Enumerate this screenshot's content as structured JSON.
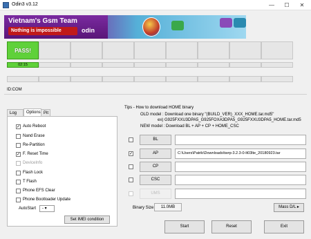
{
  "window": {
    "title": "Odin3 v3.12",
    "minimize": "—",
    "maximize": "☐",
    "close": "✕"
  },
  "banner": {
    "team": "Vietnam's Gsm Team",
    "slogan": "Nothing is impossible",
    "brand": "odin"
  },
  "slots": {
    "pass_label": "PASS!",
    "elapsed": "02:15"
  },
  "id_com": "ID:COM",
  "tabs": {
    "log": "Log",
    "options": "Options",
    "pit": "Pit"
  },
  "options": [
    {
      "label": "Auto Reboot",
      "checked": true,
      "enabled": true
    },
    {
      "label": "Nand Erase",
      "checked": false,
      "enabled": true
    },
    {
      "label": "Re-Partition",
      "checked": false,
      "enabled": true
    },
    {
      "label": "F. Reset Time",
      "checked": true,
      "enabled": true
    },
    {
      "label": "DeviceInfo",
      "checked": false,
      "enabled": false
    },
    {
      "label": "Flash Lock",
      "checked": false,
      "enabled": true
    },
    {
      "label": "T Flash",
      "checked": false,
      "enabled": true
    },
    {
      "label": "Phone EFS Clear",
      "checked": false,
      "enabled": true
    },
    {
      "label": "Phone Bootloader Update",
      "checked": false,
      "enabled": true
    }
  ],
  "autostart": {
    "label": "AutoStart",
    "value": "-"
  },
  "set_imei_label": "Set IMEI condition",
  "tips": {
    "heading": "Tips - How to download HOME binary",
    "old_model": "OLD model  : Download one binary    \"(BUILD_VER)_XXX_HOME.tar.md5\"",
    "example": "ex) G925FXXU3DPA5_G925FOXA3DPA5_G925FXXU3DPA5_HOME.tar.md5",
    "new_model": "NEW model : Download BL + AP + CP + HOME_CSC"
  },
  "files": [
    {
      "label": "BL",
      "checked": false,
      "enabled": true,
      "path": ""
    },
    {
      "label": "AP",
      "checked": true,
      "enabled": true,
      "path": "C:\\Users\\Patrik\\Downloads\\twrp-3.2.3-0-lt03lte_20180923.tar"
    },
    {
      "label": "CP",
      "checked": false,
      "enabled": true,
      "path": ""
    },
    {
      "label": "CSC",
      "checked": false,
      "enabled": true,
      "path": ""
    },
    {
      "label": "UMS",
      "checked": false,
      "enabled": false,
      "path": ""
    }
  ],
  "binary_size": {
    "label": "Binary Size",
    "value": "11.0MB"
  },
  "mass_dl_label": "Mass D/L ▸",
  "actions": {
    "start": "Start",
    "reset": "Reset",
    "exit": "Exit"
  },
  "colors": {
    "pass": "#5fd13a",
    "banner_purple": "#6b1a8c",
    "banner_red": "#c01a1a"
  }
}
